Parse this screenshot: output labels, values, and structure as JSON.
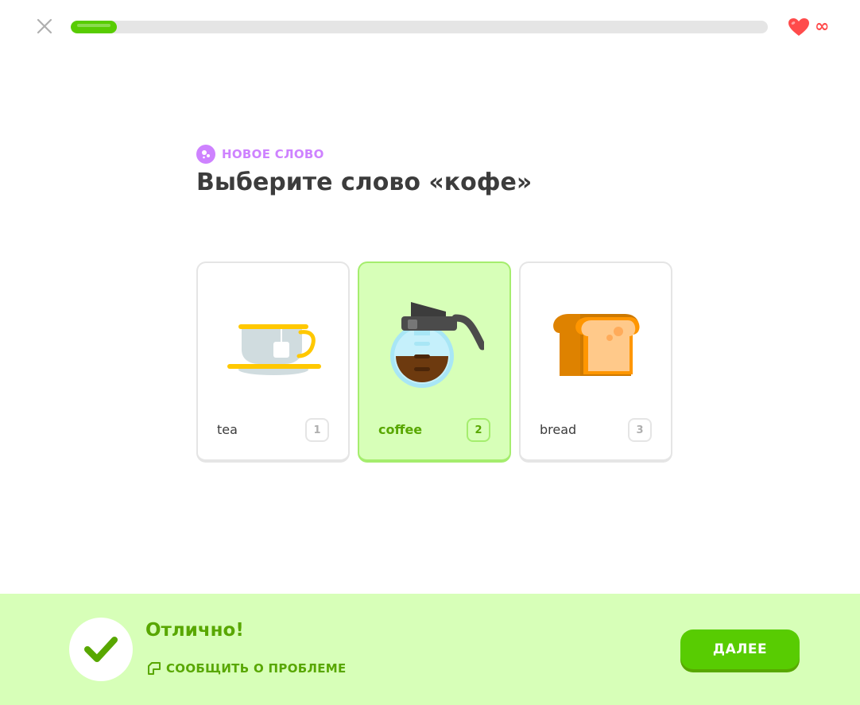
{
  "header": {
    "progress_percent": 6.6,
    "lives": "∞"
  },
  "challenge": {
    "badge_label": "НОВОЕ СЛОВО",
    "prompt": "Выберите слово «кофе»"
  },
  "options": [
    {
      "label": "tea",
      "key": "1",
      "icon": "tea-cup-icon",
      "selected": false
    },
    {
      "label": "coffee",
      "key": "2",
      "icon": "coffee-pot-icon",
      "selected": true
    },
    {
      "label": "bread",
      "key": "3",
      "icon": "bread-icon",
      "selected": false
    }
  ],
  "feedback": {
    "title": "Отлично!",
    "report_label": "СООБЩИТЬ О ПРОБЛЕМЕ",
    "continue_label": "ДАЛЕЕ"
  },
  "colors": {
    "accent_green": "#58cc02",
    "success_bg": "#d7ffb8",
    "success_text": "#58a700",
    "heart_red": "#ff4b4b",
    "new_word_purple": "#ce82ff"
  }
}
